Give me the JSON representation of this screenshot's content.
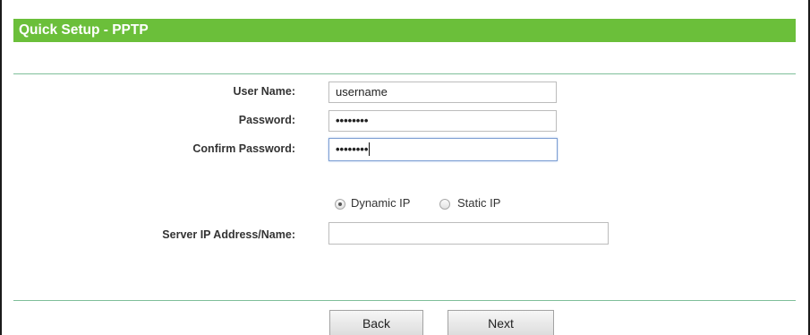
{
  "header": {
    "title": "Quick Setup - PPTP"
  },
  "form": {
    "username": {
      "label": "User Name:",
      "value": "username"
    },
    "password": {
      "label": "Password:",
      "masked_value": "••••••••"
    },
    "confirm_password": {
      "label": "Confirm Password:",
      "masked_value": "••••••••"
    },
    "ip_mode": {
      "options": [
        {
          "label": "Dynamic IP",
          "selected": true
        },
        {
          "label": "Static IP",
          "selected": false
        }
      ]
    },
    "server": {
      "label": "Server IP Address/Name:",
      "value": ""
    }
  },
  "buttons": {
    "back": "Back",
    "next": "Next"
  },
  "colors": {
    "title_bar": "#6bbf3a",
    "divider": "#7fbf9a",
    "focus_border": "#7d9fd3"
  }
}
